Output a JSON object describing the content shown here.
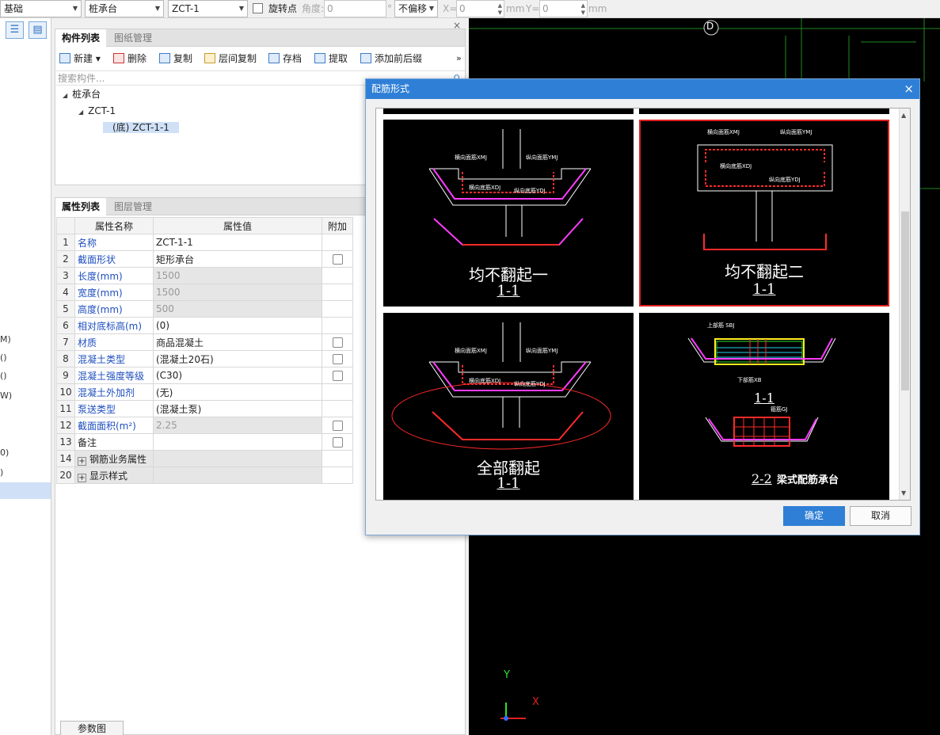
{
  "toolbar": {
    "category": "基础",
    "subtype": "桩承台",
    "component": "ZCT-1",
    "rotate_label": "旋转点",
    "angle_label": "角度:",
    "angle_value": "0",
    "degree_unit": "°",
    "offset": "不偏移",
    "x_label": "X=",
    "x_value": "0",
    "unit1": "mm",
    "y_label": "Y=",
    "y_value": "0",
    "unit2": "mm"
  },
  "left_strip": {
    "letters": [
      "M)",
      "()",
      "()",
      "W)",
      "0)",
      ")"
    ]
  },
  "component_panel": {
    "tabs": [
      "构件列表",
      "图纸管理"
    ],
    "toolbar": [
      "新建 ▾",
      "删除",
      "复制",
      "层间复制",
      "存档",
      "提取",
      "添加前后缀"
    ],
    "more": "»",
    "search_placeholder": "搜索构件...",
    "tree": {
      "root": "桩承台",
      "child": "ZCT-1",
      "leaf": "(底) ZCT-1-1"
    },
    "close": "×"
  },
  "property_panel": {
    "tabs": [
      "属性列表",
      "图层管理"
    ],
    "headers": [
      "属性名称",
      "属性值",
      "附加"
    ],
    "rows": [
      {
        "n": "1",
        "name": "名称",
        "value": "ZCT-1-1"
      },
      {
        "n": "2",
        "name": "截面形状",
        "value": "矩形承台"
      },
      {
        "n": "3",
        "name": "长度(mm)",
        "value": "1500"
      },
      {
        "n": "4",
        "name": "宽度(mm)",
        "value": "1500"
      },
      {
        "n": "5",
        "name": "高度(mm)",
        "value": "500"
      },
      {
        "n": "6",
        "name": "相对底标高(m)",
        "value": "(0)"
      },
      {
        "n": "7",
        "name": "材质",
        "value": "商品混凝土"
      },
      {
        "n": "8",
        "name": "混凝土类型",
        "value": "(混凝土20石)"
      },
      {
        "n": "9",
        "name": "混凝土强度等级",
        "value": "(C30)"
      },
      {
        "n": "10",
        "name": "混凝土外加剂",
        "value": "(无)"
      },
      {
        "n": "11",
        "name": "泵送类型",
        "value": "(混凝土泵)"
      },
      {
        "n": "12",
        "name": "截面面积(m²)",
        "value": "2.25"
      },
      {
        "n": "13",
        "name": "备注",
        "value": ""
      },
      {
        "n": "14",
        "name": "钢筋业务属性",
        "value": ""
      },
      {
        "n": "20",
        "name": "显示样式",
        "value": ""
      }
    ],
    "param_button": "参数图"
  },
  "cad": {
    "axis_label": "D",
    "x_axis": "X",
    "y_axis": "Y"
  },
  "dialog": {
    "title": "配筋形式",
    "close": "×",
    "options": [
      {
        "title": "均不翻起一",
        "section": "1-1"
      },
      {
        "title": "均不翻起二",
        "section": "1-1"
      },
      {
        "title": "全部翻起",
        "section": "1-1"
      },
      {
        "title": "梁式配筋承台",
        "section1": "1-1",
        "section2": "2-2"
      }
    ],
    "labels": {
      "hmj": "横向面筋XMJ",
      "vmj": "纵向面筋YMJ",
      "hdj": "横向底筋XDJ",
      "vdj": "纵向底筋YDJ",
      "top_bar": "上部筋 SBJ",
      "bottom_bar": "下部筋XB",
      "stirrup": "箍筋GJ"
    },
    "ok": "确定",
    "cancel": "取消"
  },
  "colors": {
    "accent": "#2f7fd6",
    "selected_border": "#e02020",
    "rebar_red": "#ff2a2a",
    "rebar_magenta": "#ff3cff",
    "grid_green": "#1f8a1f"
  }
}
